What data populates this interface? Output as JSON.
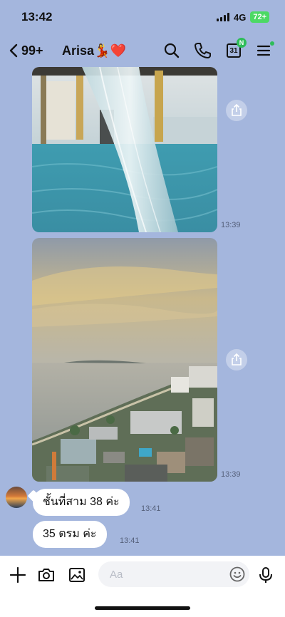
{
  "status": {
    "time": "13:42",
    "network": "4G",
    "battery": "72+"
  },
  "header": {
    "back_count": "99+",
    "title": "Arisa💃❤️",
    "calendar_day": "31",
    "calendar_badge": "N"
  },
  "messages": {
    "photo1_time": "13:39",
    "photo2_time": "13:39",
    "text1": "ชั้นที่สาม 38 ค่ะ",
    "text1_time": "13:41",
    "text2": "35 ตรม ค่ะ",
    "text2_time": "13:41"
  },
  "composer": {
    "placeholder": "Aa"
  },
  "colors": {
    "chat_background": "#a4b6dd",
    "badge_green": "#2ebd59",
    "battery_green": "#4cd964"
  }
}
